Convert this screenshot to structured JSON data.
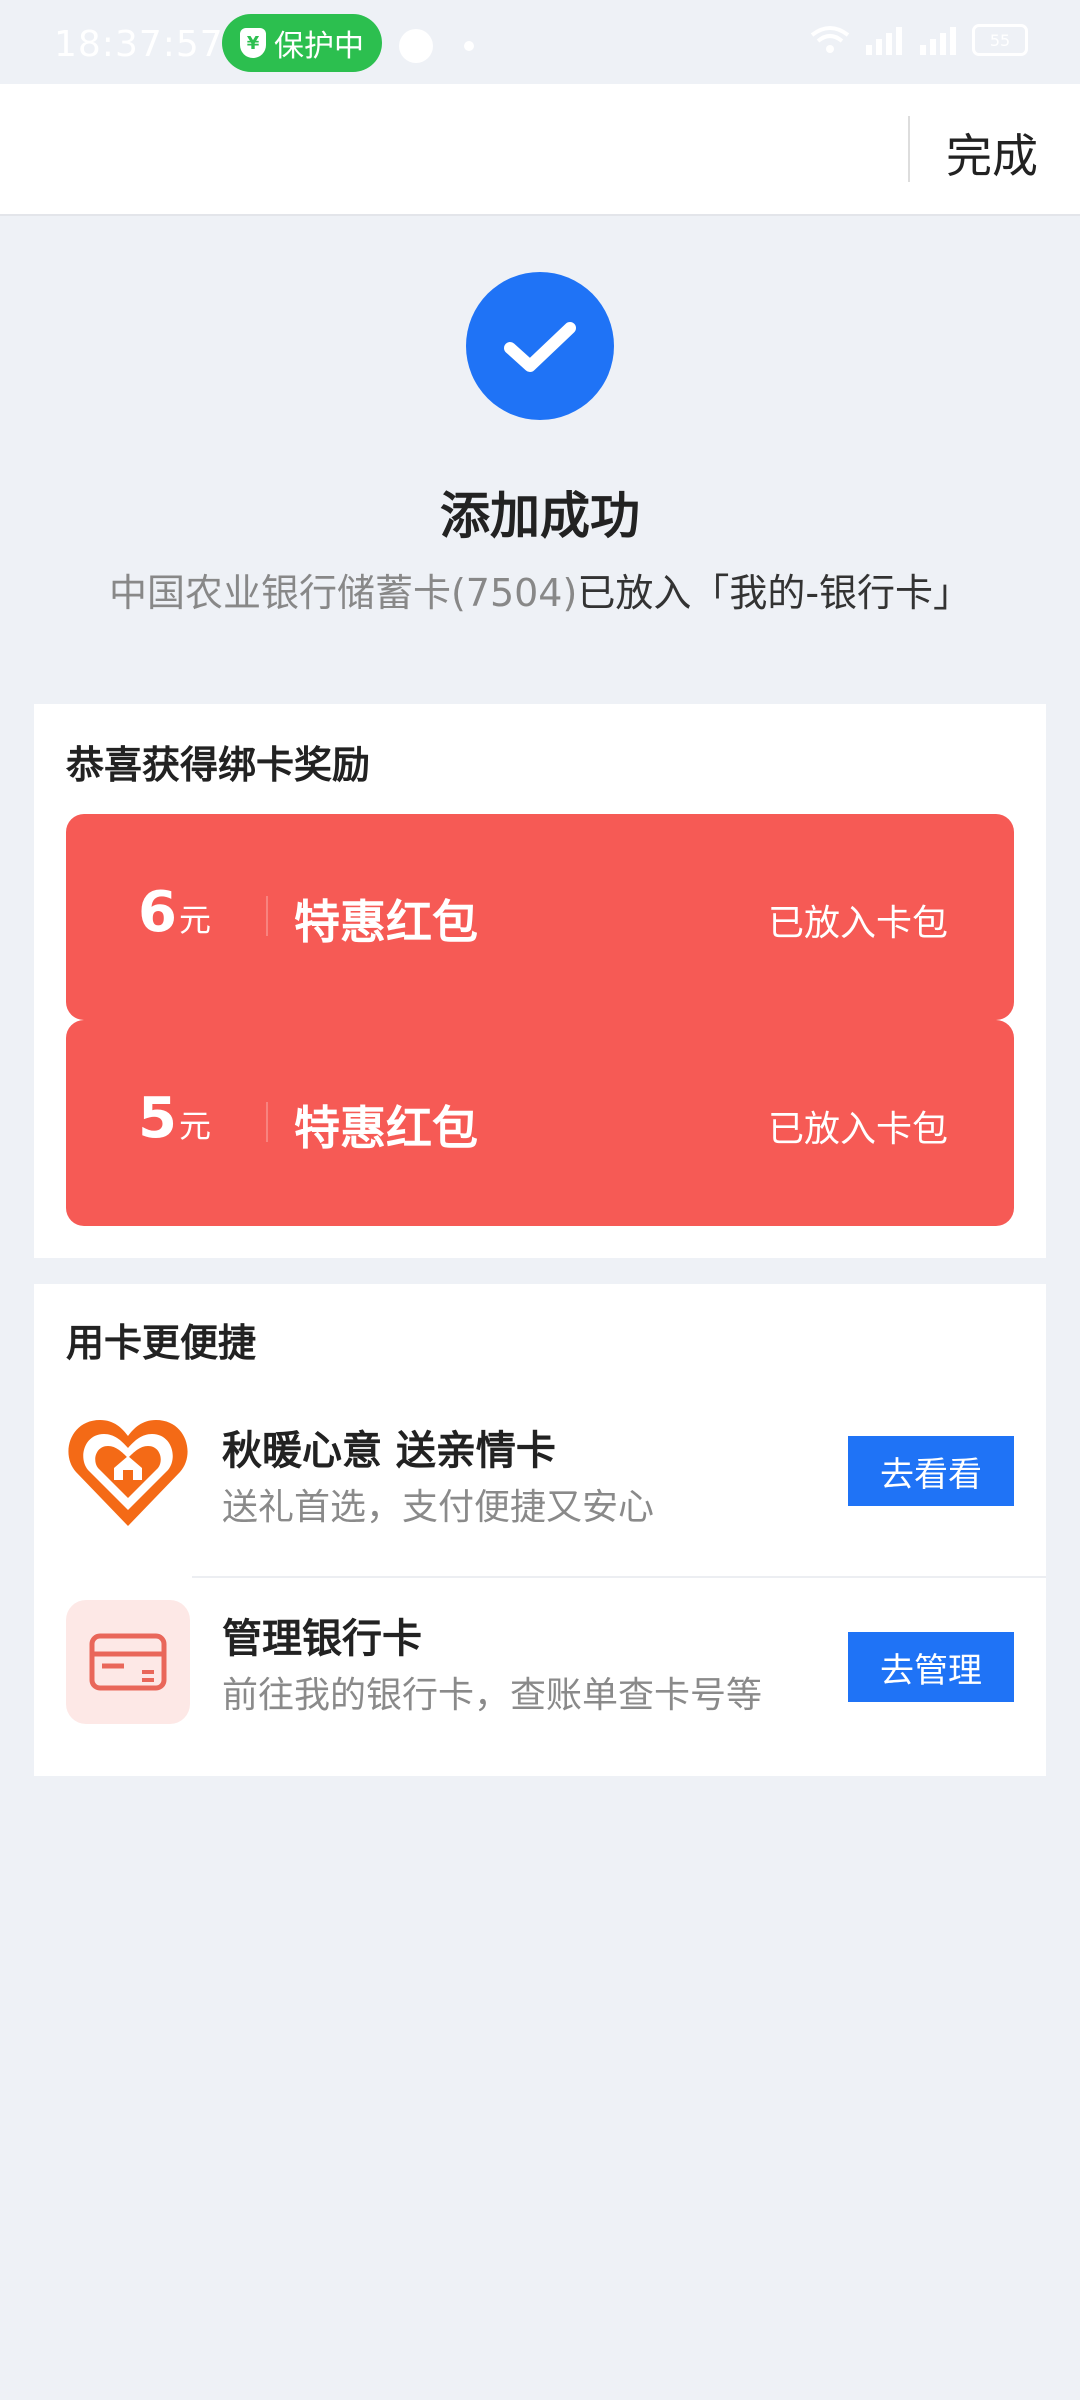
{
  "status_bar": {
    "time": "18:37:57",
    "protect_label": "保护中",
    "shield_glyph": "¥",
    "battery": "55"
  },
  "header": {
    "done_label": "完成"
  },
  "success": {
    "title": "添加成功",
    "subtitle_prefix": "中国农业银行储蓄卡(7504)",
    "subtitle_suffix": "已放入「我的-银行卡」"
  },
  "reward": {
    "title": "恭喜获得绑卡奖励",
    "coupons": [
      {
        "amount": "6",
        "unit": "元",
        "name": "特惠红包",
        "status": "已放入卡包"
      },
      {
        "amount": "5",
        "unit": "元",
        "name": "特惠红包",
        "status": "已放入卡包"
      }
    ]
  },
  "services": {
    "title": "用卡更便捷",
    "items": [
      {
        "title": "秋暖心意 送亲情卡",
        "desc": "送礼首选，支付便捷又安心",
        "action": "去看看",
        "icon": "heart-house-icon"
      },
      {
        "title": "管理银行卡",
        "desc": "前往我的银行卡，查账单查卡号等",
        "action": "去管理",
        "icon": "bank-card-icon"
      }
    ]
  },
  "colors": {
    "accent_blue": "#1f73f6",
    "coupon_red": "#f65a55",
    "protect_green": "#2cbf4f",
    "background": "#eef1f6"
  }
}
